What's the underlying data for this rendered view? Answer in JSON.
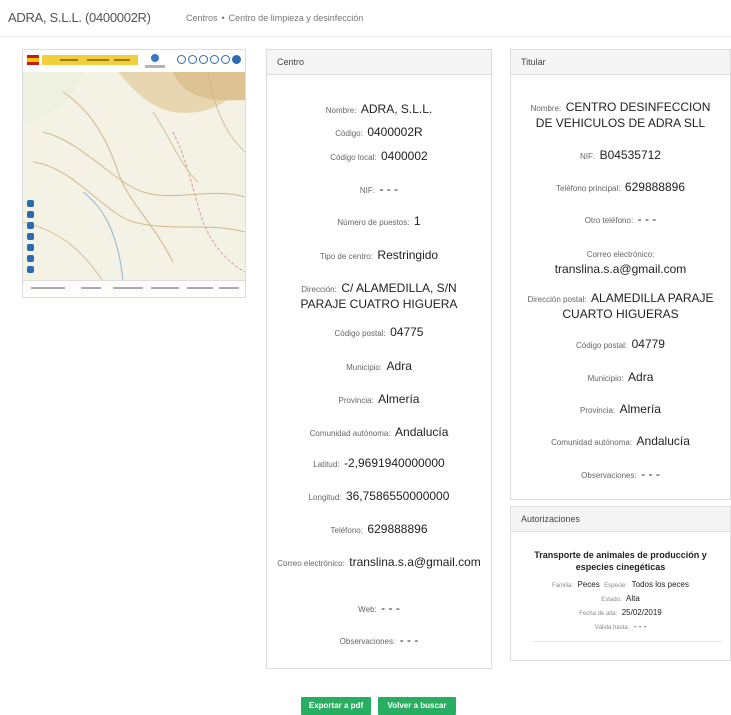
{
  "page": {
    "title": "ADRA, S.L.L. (0400002R)",
    "breadcrumb": [
      "Centros",
      "Centro de limpieza y desinfección"
    ],
    "breadcrumb_separator": "•"
  },
  "map": {
    "controls": [
      "info-icon",
      "info-icon",
      "info-icon",
      "info-icon",
      "info-icon",
      "layers-icon"
    ],
    "tools": [
      "zoom-in-icon",
      "zoom-out-icon",
      "pan-icon",
      "locate-icon",
      "measure-icon",
      "print-icon",
      "home-icon"
    ]
  },
  "centro": {
    "header": "Centro",
    "fields": [
      {
        "label": "Nombre:",
        "value": "ADRA, S.L.L."
      },
      {
        "label": "Código:",
        "value": "0400002R"
      },
      {
        "label": "Código local:",
        "value": "0400002"
      },
      {
        "label": "NIF:",
        "value": "- - -"
      },
      {
        "label": "Número de puestos:",
        "value": "1"
      },
      {
        "label": "Tipo de centro:",
        "value": "Restringido"
      },
      {
        "label": "Dirección:",
        "value": "C/ ALAMEDILLA, S/N PARAJE CUATRO HIGUERA"
      },
      {
        "label": "Código postal:",
        "value": "04775"
      },
      {
        "label": "Municipio:",
        "value": "Adra"
      },
      {
        "label": "Provincia:",
        "value": "Almería"
      },
      {
        "label": "Comunidad autónoma:",
        "value": "Andalucía"
      },
      {
        "label": "Latitud:",
        "value": "-2,9691940000000"
      },
      {
        "label": "Longitud:",
        "value": "36,7586550000000"
      },
      {
        "label": "Teléfono:",
        "value": "629888896"
      },
      {
        "label": "Correo electrónico:",
        "value": "translina.s.a@gmail.com"
      },
      {
        "label": "Web:",
        "value": "- - -"
      },
      {
        "label": "Observaciones:",
        "value": "- - -"
      }
    ]
  },
  "titular": {
    "header": "Titular",
    "fields": [
      {
        "label": "Nombre:",
        "value": "CENTRO DESINFECCION DE VEHICULOS DE ADRA SLL"
      },
      {
        "label": "NIF:",
        "value": "B04535712"
      },
      {
        "label": "Teléfono principal:",
        "value": "629888896"
      },
      {
        "label": "Otro teléfono:",
        "value": "- - -"
      },
      {
        "label": "Correo electrónico:",
        "value": "translina.s.a@gmail.com"
      },
      {
        "label": "Dirección postal:",
        "value": "ALAMEDILLA PARAJE CUARTO HIGUERAS"
      },
      {
        "label": "Código postal:",
        "value": "04779"
      },
      {
        "label": "Municipio:",
        "value": "Adra"
      },
      {
        "label": "Provincia:",
        "value": "Almería"
      },
      {
        "label": "Comunidad autónoma:",
        "value": "Andalucía"
      },
      {
        "label": "Observaciones:",
        "value": "- - -"
      }
    ]
  },
  "autorizaciones": {
    "header": "Autorizaciones",
    "items": [
      {
        "title": "Transporte de animales de producción y especies cinegéticas",
        "familia_label": "Familia:",
        "familia": "Peces",
        "especie_label": "Especie:",
        "especie": "Todos los peces",
        "estado_label": "Estado:",
        "estado": "Alta",
        "fecha_label": "Fecha de alta:",
        "fecha": "25/02/2019",
        "valida_label": "Válida hasta:",
        "valida": "- - -"
      }
    ]
  },
  "buttons": {
    "export_pdf": "Exportar a pdf",
    "back_search": "Volver a buscar"
  },
  "colors": {
    "button_bg": "#27ae60",
    "card_header_bg": "#f5f5f5",
    "border": "#dddddd"
  }
}
